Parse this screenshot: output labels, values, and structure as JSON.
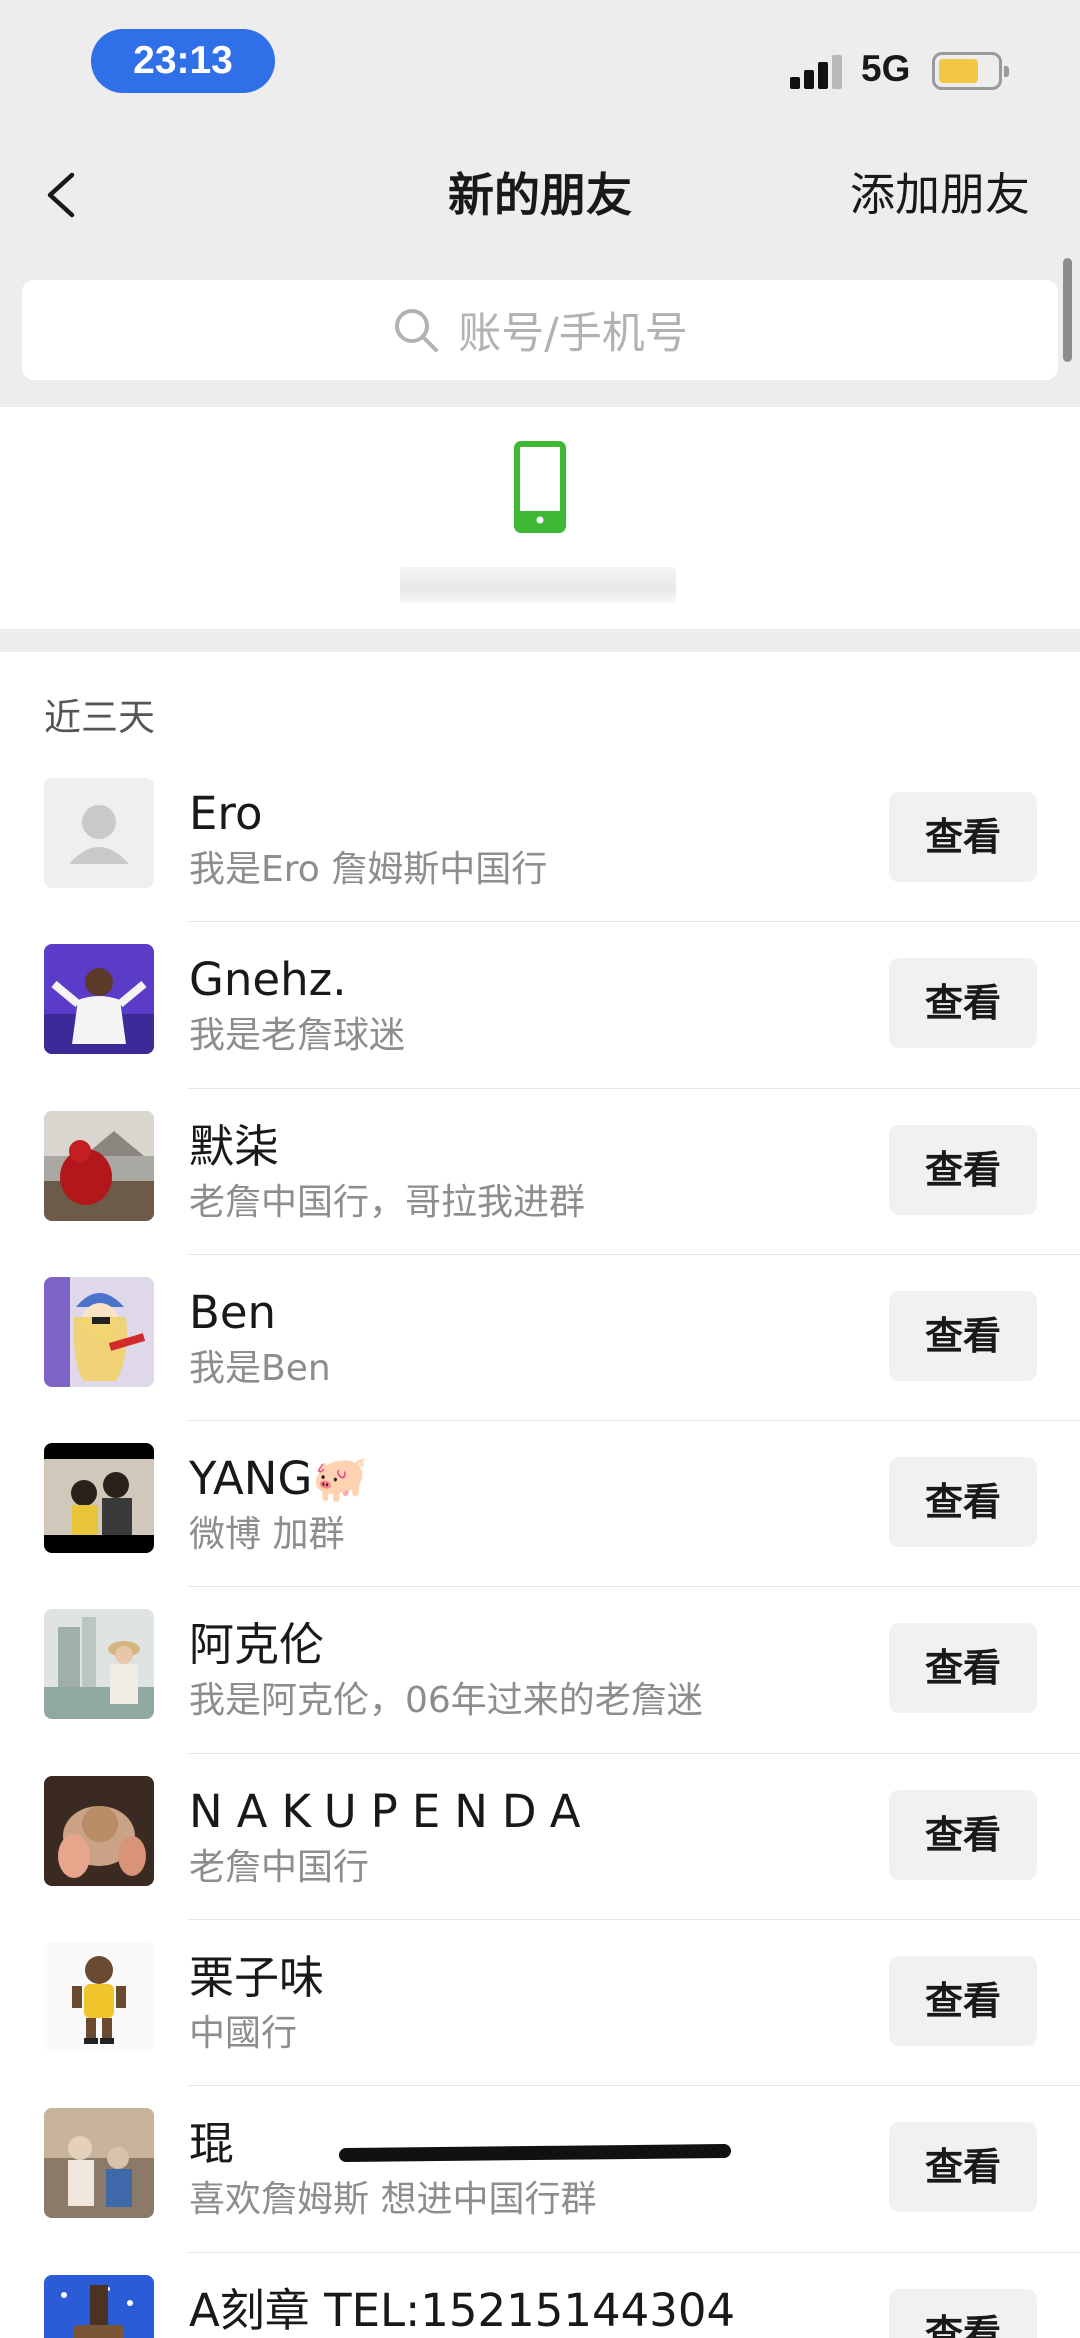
{
  "status_bar": {
    "time": "23:13",
    "network": "5G",
    "battery_color": "#f2c744",
    "time_pill_color": "#2f6fe7"
  },
  "nav": {
    "back_icon": "chevron-left-icon",
    "title": "新的朋友",
    "action_label": "添加朋友"
  },
  "search": {
    "icon": "search-icon",
    "placeholder": "账号/手机号"
  },
  "phone_contacts": {
    "icon": "phone-icon",
    "icon_color": "#3eb935"
  },
  "section": {
    "label": "近三天"
  },
  "requests": [
    {
      "name": "Ero",
      "message": "我是Ero 詹姆斯中国行",
      "button": "查看"
    },
    {
      "name": "Gnehz.",
      "message": "我是老詹球迷",
      "button": "查看"
    },
    {
      "name": "默柒",
      "message": "老詹中国行，哥拉我进群",
      "button": "查看"
    },
    {
      "name": "Ben",
      "message": "我是Ben",
      "button": "查看"
    },
    {
      "name": "YANG🐖",
      "message": "微博 加群",
      "button": "查看"
    },
    {
      "name": "阿克伦",
      "message": "我是阿克伦，06年过来的老詹迷",
      "button": "查看"
    },
    {
      "name": "NAKUPENDA",
      "message": "老詹中国行",
      "button": "查看"
    },
    {
      "name": "栗子味",
      "message": "中國行",
      "button": "查看"
    },
    {
      "name": "琨",
      "message": "喜欢詹姆斯 想进中国行群",
      "button": "查看"
    },
    {
      "name": "A刻章 TEL:15215144304",
      "message": "",
      "button": "查看"
    }
  ]
}
